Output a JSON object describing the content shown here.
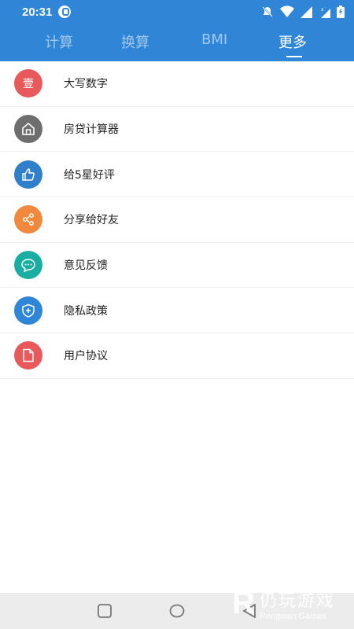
{
  "status_bar": {
    "time": "20:31",
    "icons": [
      "app-icon",
      "mute-icon",
      "wifi-icon",
      "signal-icon",
      "no-signal-icon",
      "battery-icon"
    ]
  },
  "tabs": [
    {
      "label": "计算",
      "active": false
    },
    {
      "label": "换算",
      "active": false
    },
    {
      "label": "BMI",
      "active": false
    },
    {
      "label": "更多",
      "active": true
    }
  ],
  "menu": [
    {
      "label": "大写数字",
      "icon": "壹",
      "icon_name": "uppercase-number-icon",
      "color": "#E9585A"
    },
    {
      "label": "房贷计算器",
      "icon": "house",
      "icon_name": "house-icon",
      "color": "#6E6E6E"
    },
    {
      "label": "给5星好评",
      "icon": "thumbs-up",
      "icon_name": "thumbs-up-icon",
      "color": "#2F7FCB"
    },
    {
      "label": "分享给好友",
      "icon": "share",
      "icon_name": "share-icon",
      "color": "#F0883E"
    },
    {
      "label": "意见反馈",
      "icon": "chat",
      "icon_name": "feedback-icon",
      "color": "#1AAEA3"
    },
    {
      "label": "隐私政策",
      "icon": "shield",
      "icon_name": "shield-icon",
      "color": "#2F86D6"
    },
    {
      "label": "用户协议",
      "icon": "document",
      "icon_name": "document-icon",
      "color": "#E9585A"
    }
  ],
  "watermark": {
    "cn": "仍玩游戏",
    "en": "Rengwan Games"
  },
  "colors": {
    "header": "#2F86D6",
    "nav_bar": "#ECECEC"
  }
}
